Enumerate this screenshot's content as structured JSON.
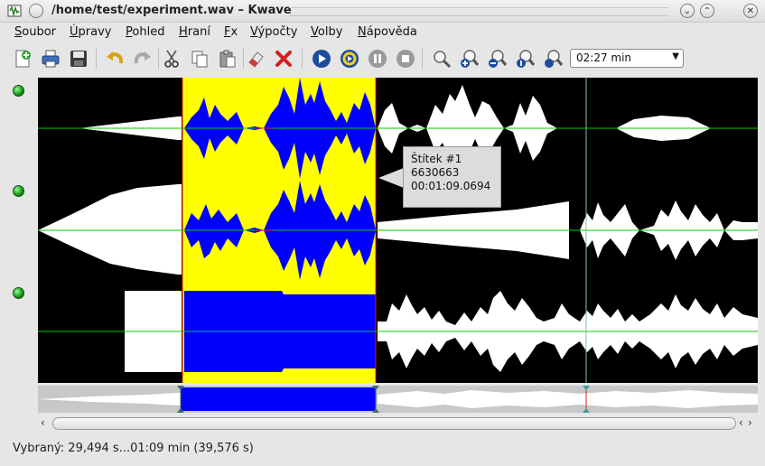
{
  "window": {
    "title": "/home/test/experiment.wav – Kwave",
    "buttons": [
      "minimize",
      "maximize",
      "close"
    ]
  },
  "menu": [
    {
      "label": "Soubor",
      "mnemonic": "S",
      "rest": "oubor"
    },
    {
      "label": "Úpravy",
      "mnemonic": "Ú",
      "rest": "pravy"
    },
    {
      "label": "Pohled",
      "mnemonic": "P",
      "rest": "ohled"
    },
    {
      "label": "Hraní",
      "mnemonic": "H",
      "rest": "raní"
    },
    {
      "label": "Fx",
      "mnemonic": "F",
      "rest": "x"
    },
    {
      "label": "Výpočty",
      "mnemonic": "V",
      "rest": "ýpočty"
    },
    {
      "label": "Volby",
      "mnemonic": "V",
      "rest": "olby"
    },
    {
      "label": "Nápověda",
      "mnemonic": "N",
      "rest": "ápověda"
    }
  ],
  "toolbar": {
    "icons": [
      "new-file-icon",
      "print-icon",
      "save-icon",
      "undo-icon",
      "redo-icon",
      "cut-icon",
      "copy-icon",
      "paste-icon",
      "erase-icon",
      "delete-icon",
      "play-icon",
      "loop-icon",
      "pause-icon",
      "stop-icon",
      "zoom-selection-icon",
      "zoom-in-icon",
      "zoom-out-icon",
      "zoom-normal-icon",
      "zoom-all-icon"
    ],
    "zoom_value": "02:27 min"
  },
  "channels": 3,
  "tooltip": {
    "line1": "Štítek #1",
    "line2": "6630663",
    "line3": "00:01:09.0694"
  },
  "colors": {
    "selection": "#ffff00",
    "selected_wave": "#0000ff",
    "wave": "#ffffff",
    "background": "#000000",
    "zero_line": "#00cc00",
    "marker": "#7fbfbf"
  },
  "status": {
    "text": "Vybraný: 29,494 s...01:09 min (39,576 s)"
  }
}
